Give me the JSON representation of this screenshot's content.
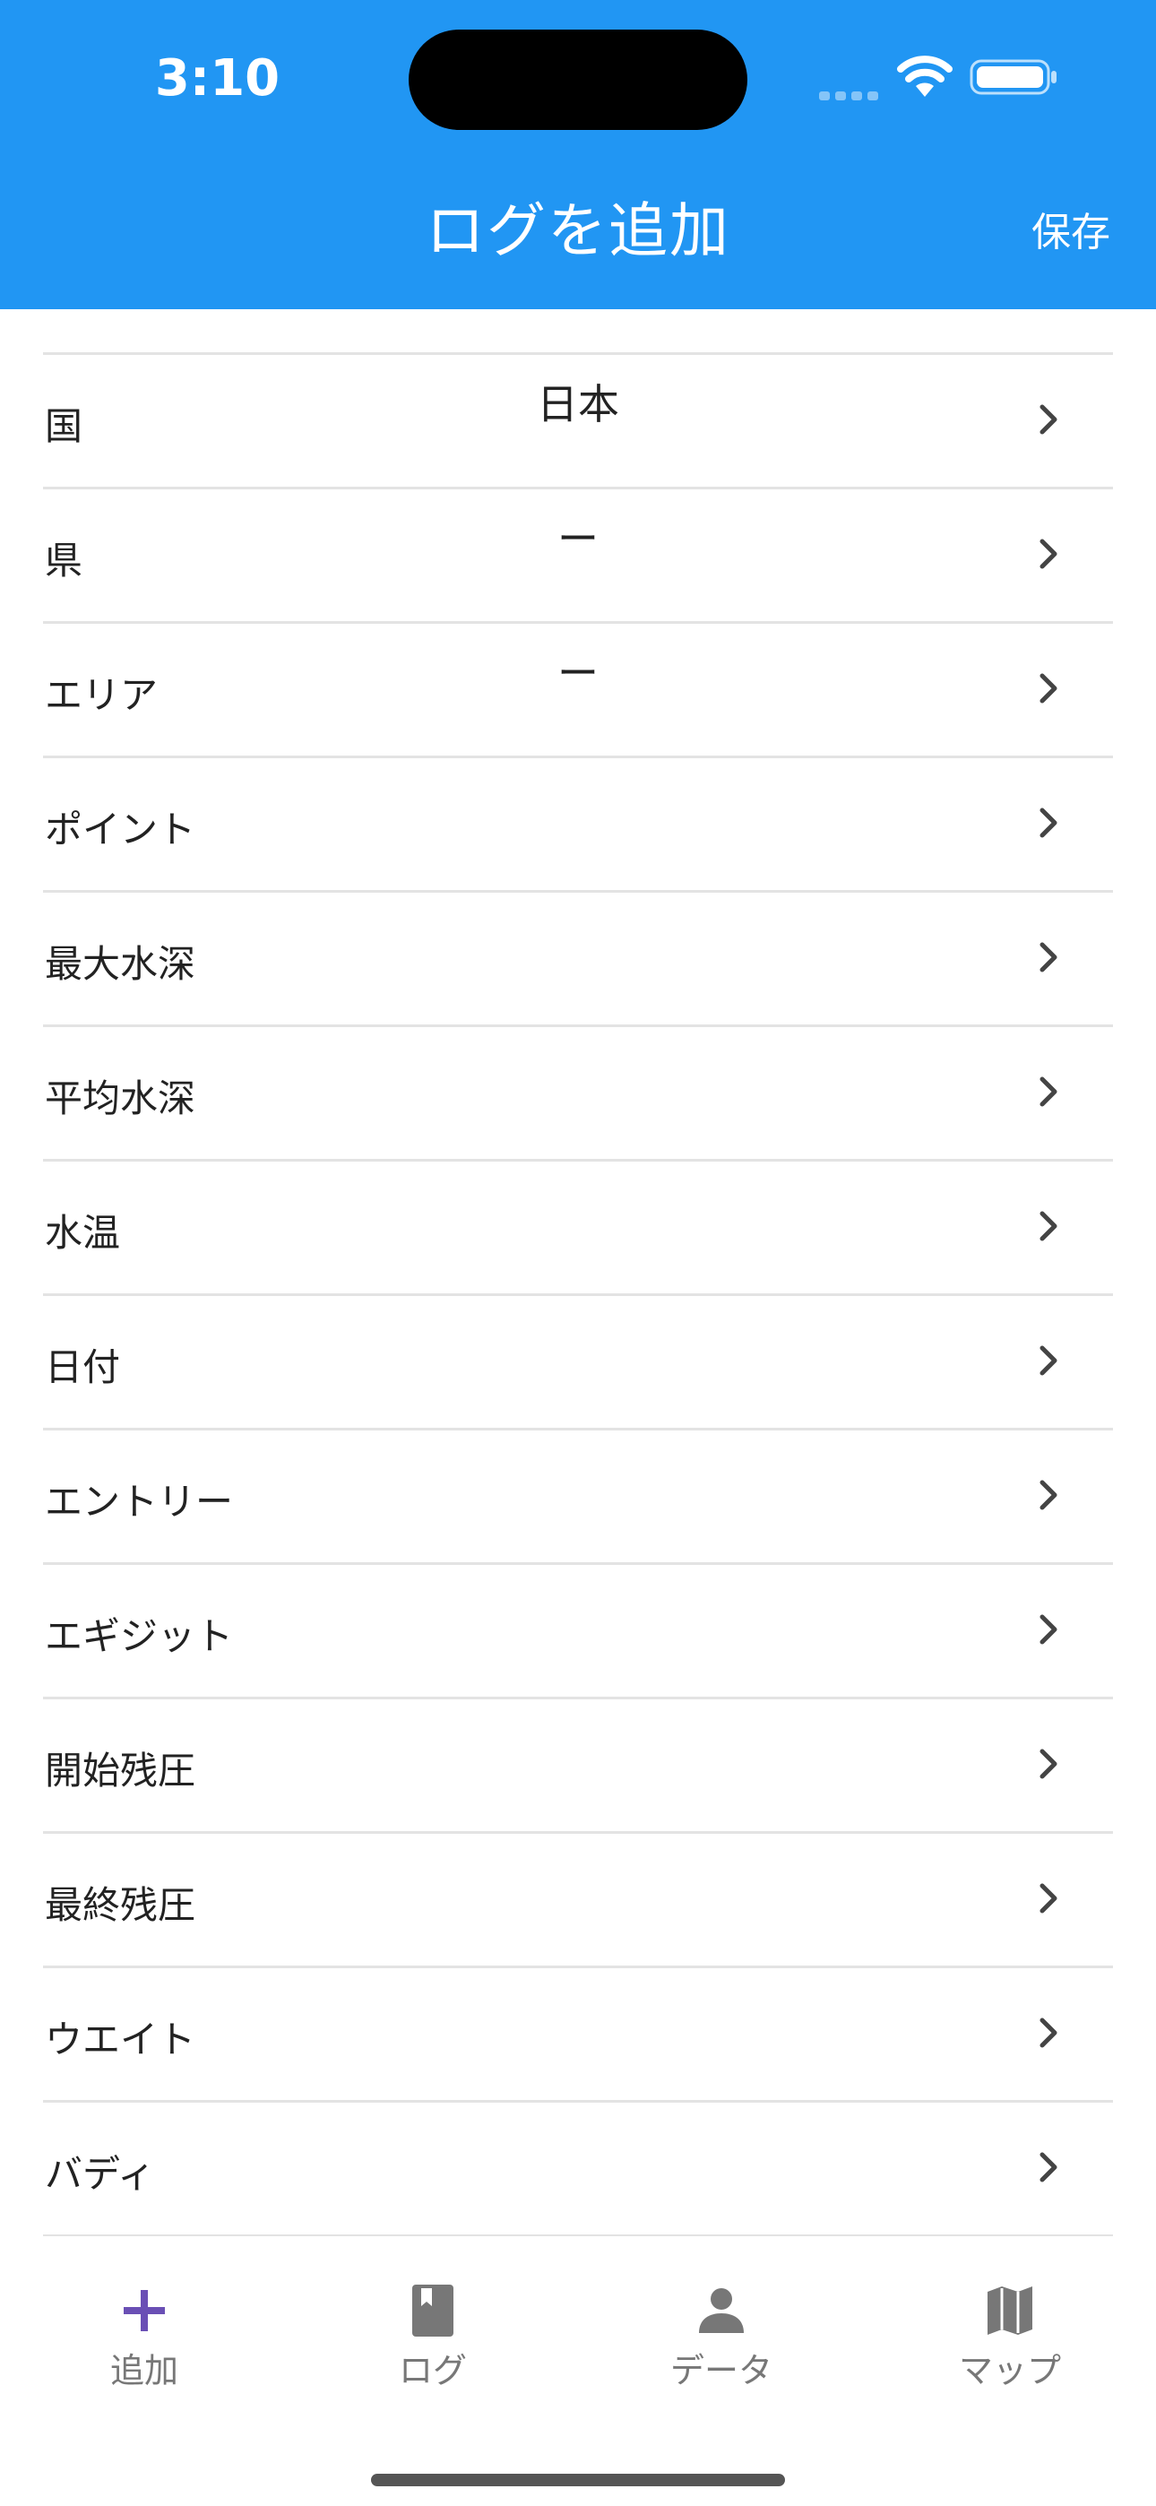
{
  "status_bar": {
    "time": "3:10"
  },
  "nav": {
    "title": "ログを追加",
    "save_label": "保存"
  },
  "colors": {
    "primary": "#2196F3",
    "tab_active": "#6a4fb5",
    "tab_inactive": "#777777",
    "divider": "#e3e3e3"
  },
  "form": {
    "rows": [
      {
        "label": "国",
        "value": "日本"
      },
      {
        "label": "県",
        "value": "ー"
      },
      {
        "label": "エリア",
        "value": "ー"
      },
      {
        "label": "ポイント",
        "value": ""
      },
      {
        "label": "最大水深",
        "value": ""
      },
      {
        "label": "平均水深",
        "value": ""
      },
      {
        "label": "水温",
        "value": ""
      },
      {
        "label": "日付",
        "value": ""
      },
      {
        "label": "エントリー",
        "value": ""
      },
      {
        "label": "エギジット",
        "value": ""
      },
      {
        "label": "開始残圧",
        "value": ""
      },
      {
        "label": "最終残圧",
        "value": ""
      },
      {
        "label": "ウエイト",
        "value": ""
      },
      {
        "label": "バディ",
        "value": ""
      }
    ]
  },
  "tabs": [
    {
      "label": "追加",
      "icon": "plus-icon",
      "active": true
    },
    {
      "label": "ログ",
      "icon": "book-icon",
      "active": false
    },
    {
      "label": "データ",
      "icon": "person-icon",
      "active": false
    },
    {
      "label": "マップ",
      "icon": "map-icon",
      "active": false
    }
  ]
}
